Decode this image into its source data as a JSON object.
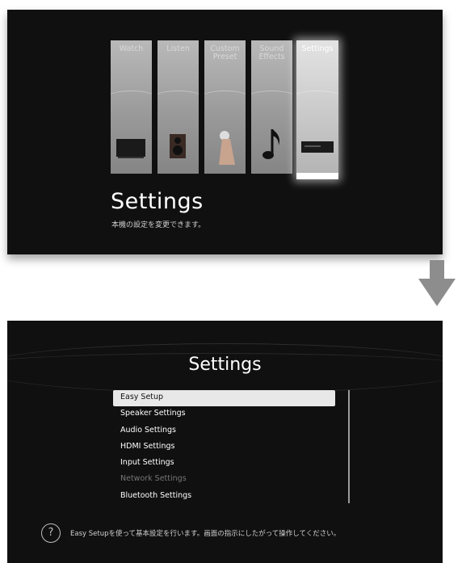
{
  "screen1": {
    "tiles": [
      {
        "label": "Watch",
        "icon": "tv-icon"
      },
      {
        "label": "Listen",
        "icon": "speaker-icon"
      },
      {
        "label": "Custom\nPreset",
        "icon": "hand-icon"
      },
      {
        "label": "Sound\nEffects",
        "icon": "music-note-icon"
      },
      {
        "label": "Settings",
        "icon": "receiver-icon"
      }
    ],
    "selected_tile": "Settings",
    "title": "Settings",
    "description": "本機の設定を変更できます。"
  },
  "arrow": {
    "icon": "down-arrow-icon"
  },
  "screen2": {
    "title": "Settings",
    "menu": [
      {
        "label": "Easy Setup",
        "state": "selected"
      },
      {
        "label": "Speaker Settings",
        "state": "normal"
      },
      {
        "label": "Audio Settings",
        "state": "normal"
      },
      {
        "label": "HDMI Settings",
        "state": "normal"
      },
      {
        "label": "Input Settings",
        "state": "normal"
      },
      {
        "label": "Network Settings",
        "state": "disabled"
      },
      {
        "label": "Bluetooth Settings",
        "state": "normal"
      }
    ],
    "help_icon": "?",
    "help_text": "Easy Setupを使って基本設定を行います。画面の指示にしたがって操作してください。"
  },
  "colors": {
    "background": "#101010",
    "selected_bg": "#e8e8e8",
    "disabled": "#777777"
  }
}
